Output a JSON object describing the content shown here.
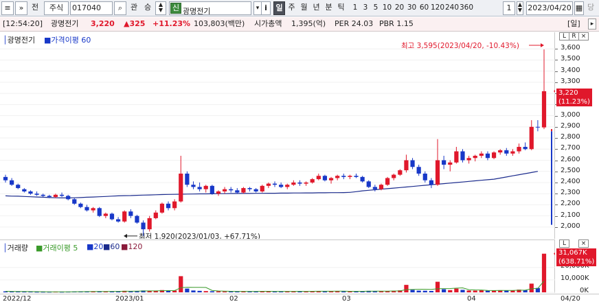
{
  "toolbar": {
    "menu_icon": "hamburger-icon",
    "collapse_icon": "double-chevron-icon",
    "tab_all": "전",
    "market": "주식",
    "code": "017040",
    "search_icon": "magnifier-icon",
    "tab_related": "관",
    "tab_compare": "승",
    "updown_icon": "spin-arrows-icon",
    "stock_tag": "신",
    "stock_name": "광명전기",
    "info_button": "i",
    "periods": [
      "일",
      "주",
      "월",
      "년",
      "분",
      "틱"
    ],
    "selected_period": "일",
    "intervals": [
      "1",
      "3",
      "5",
      "10",
      "20",
      "30",
      "60",
      "120",
      "240",
      "360"
    ],
    "count": "1",
    "date": "2023/04/20",
    "calendar_icon": "calendar-icon",
    "extra": "당"
  },
  "infobar": {
    "time": "[12:54:20]",
    "name": "광명전기",
    "price": "3,220",
    "change": "▲325",
    "pct": "+11.23%",
    "volume": "103,803(백만)",
    "market_cap_label": "시가총액",
    "market_cap": "1,395(억)",
    "per": "PER 24.03",
    "pbr": "PBR 1.15",
    "mode": "[일]",
    "scroll_icon": "scroll-arrow-icon"
  },
  "price_panel": {
    "title": "광명전기",
    "legend": "가격이평 60",
    "max_note": "최고 3,595(2023/04/20, -10.43%)",
    "min_note": "최저 1,920(2023/01/03, +67.71%)",
    "current_label": "3,220",
    "current_pct": "(11.23%)",
    "buttons": [
      "L",
      "R"
    ],
    "colors": {
      "up": "#e0182b",
      "down": "#1838c8",
      "ma": "#1a2a8c"
    }
  },
  "volume_panel": {
    "title": "거래량",
    "legend_ma": "거래이평 5",
    "legend_20": "20",
    "legend_60": "60",
    "legend_120": "120",
    "current_label": "31,067K",
    "current_pct": "(638.71%)",
    "buttons": [
      "L"
    ]
  },
  "x_axis": {
    "labels": [
      "2022/12",
      "2023/01",
      "02",
      "03",
      "04",
      "04/20"
    ]
  },
  "chart_data": [
    {
      "type": "candlestick",
      "title": "광명전기",
      "ylim": [
        1950,
        3700
      ],
      "ticks": [
        2000,
        2100,
        2200,
        2300,
        2400,
        2500,
        2600,
        2700,
        2800,
        2900,
        3000,
        3100,
        3200,
        3300,
        3400,
        3500,
        3600
      ],
      "ma60": [
        2280,
        2278,
        2277,
        2275,
        2272,
        2270,
        2268,
        2265,
        2263,
        2262,
        2262,
        2263,
        2265,
        2268,
        2270,
        2272,
        2275,
        2278,
        2280,
        2282,
        2283,
        2285,
        2287,
        2288,
        2290,
        2292,
        2293,
        2294,
        2295,
        2296,
        2297,
        2298,
        2298,
        2299,
        2300,
        2300,
        2301,
        2301,
        2302,
        2302,
        2303,
        2303,
        2304,
        2304,
        2305,
        2305,
        2306,
        2306,
        2307,
        2307,
        2308,
        2308,
        2309,
        2309,
        2310,
        2312,
        2318,
        2325,
        2330,
        2335,
        2340,
        2345,
        2350,
        2355,
        2360,
        2365,
        2370,
        2375,
        2380,
        2385,
        2390,
        2395,
        2400,
        2405,
        2410,
        2415,
        2420,
        2425,
        2430,
        2440,
        2450,
        2460,
        2470,
        2480,
        2490,
        2500
      ],
      "ohlc": [
        [
          2450,
          2470,
          2400,
          2420
        ],
        [
          2420,
          2440,
          2370,
          2380
        ],
        [
          2380,
          2390,
          2340,
          2350
        ],
        [
          2340,
          2350,
          2310,
          2320
        ],
        [
          2320,
          2330,
          2290,
          2300
        ],
        [
          2300,
          2320,
          2280,
          2290
        ],
        [
          2290,
          2300,
          2270,
          2280
        ],
        [
          2280,
          2290,
          2260,
          2270
        ],
        [
          2270,
          2300,
          2260,
          2290
        ],
        [
          2290,
          2310,
          2270,
          2280
        ],
        [
          2280,
          2290,
          2240,
          2250
        ],
        [
          2250,
          2260,
          2200,
          2210
        ],
        [
          2210,
          2220,
          2170,
          2180
        ],
        [
          2180,
          2200,
          2140,
          2150
        ],
        [
          2150,
          2180,
          2130,
          2170
        ],
        [
          2170,
          2180,
          2090,
          2100
        ],
        [
          2100,
          2130,
          2080,
          2120
        ],
        [
          2120,
          2130,
          2060,
          2070
        ],
        [
          2070,
          2090,
          2040,
          2050
        ],
        [
          2050,
          2150,
          2040,
          2140
        ],
        [
          2140,
          2160,
          2080,
          2100
        ],
        [
          2100,
          2110,
          2030,
          2040
        ],
        [
          2040,
          2060,
          1920,
          1980
        ],
        [
          1980,
          2100,
          1960,
          2080
        ],
        [
          2080,
          2150,
          2070,
          2130
        ],
        [
          2130,
          2220,
          2120,
          2210
        ],
        [
          2210,
          2230,
          2150,
          2170
        ],
        [
          2170,
          2250,
          2150,
          2230
        ],
        [
          2230,
          2640,
          2220,
          2480
        ],
        [
          2480,
          2500,
          2360,
          2380
        ],
        [
          2380,
          2410,
          2340,
          2360
        ],
        [
          2360,
          2400,
          2320,
          2340
        ],
        [
          2340,
          2380,
          2310,
          2370
        ],
        [
          2370,
          2380,
          2290,
          2300
        ],
        [
          2300,
          2330,
          2280,
          2320
        ],
        [
          2320,
          2360,
          2300,
          2340
        ],
        [
          2340,
          2360,
          2310,
          2330
        ],
        [
          2330,
          2350,
          2300,
          2310
        ],
        [
          2310,
          2360,
          2300,
          2350
        ],
        [
          2350,
          2360,
          2320,
          2340
        ],
        [
          2340,
          2350,
          2310,
          2320
        ],
        [
          2320,
          2380,
          2310,
          2370
        ],
        [
          2370,
          2400,
          2350,
          2390
        ],
        [
          2390,
          2410,
          2360,
          2380
        ],
        [
          2380,
          2400,
          2350,
          2360
        ],
        [
          2360,
          2390,
          2340,
          2380
        ],
        [
          2380,
          2420,
          2370,
          2400
        ],
        [
          2400,
          2420,
          2370,
          2390
        ],
        [
          2390,
          2410,
          2370,
          2400
        ],
        [
          2400,
          2440,
          2390,
          2430
        ],
        [
          2430,
          2480,
          2420,
          2460
        ],
        [
          2460,
          2470,
          2410,
          2420
        ],
        [
          2420,
          2450,
          2390,
          2440
        ],
        [
          2440,
          2470,
          2420,
          2460
        ],
        [
          2460,
          2480,
          2430,
          2450
        ],
        [
          2450,
          2470,
          2430,
          2460
        ],
        [
          2460,
          2480,
          2440,
          2450
        ],
        [
          2450,
          2460,
          2400,
          2410
        ],
        [
          2410,
          2420,
          2350,
          2360
        ],
        [
          2360,
          2380,
          2320,
          2340
        ],
        [
          2340,
          2390,
          2330,
          2380
        ],
        [
          2380,
          2450,
          2370,
          2440
        ],
        [
          2440,
          2480,
          2420,
          2470
        ],
        [
          2470,
          2520,
          2460,
          2510
        ],
        [
          2510,
          2650,
          2490,
          2600
        ],
        [
          2600,
          2620,
          2520,
          2540
        ],
        [
          2540,
          2560,
          2460,
          2480
        ],
        [
          2480,
          2500,
          2400,
          2420
        ],
        [
          2420,
          2440,
          2350,
          2380
        ],
        [
          2380,
          2790,
          2370,
          2600
        ],
        [
          2600,
          2640,
          2520,
          2560
        ],
        [
          2560,
          2600,
          2500,
          2580
        ],
        [
          2580,
          2720,
          2570,
          2680
        ],
        [
          2680,
          2700,
          2580,
          2600
        ],
        [
          2600,
          2640,
          2570,
          2620
        ],
        [
          2620,
          2650,
          2590,
          2640
        ],
        [
          2640,
          2680,
          2620,
          2660
        ],
        [
          2660,
          2680,
          2600,
          2620
        ],
        [
          2620,
          2680,
          2610,
          2670
        ],
        [
          2670,
          2700,
          2650,
          2690
        ],
        [
          2690,
          2710,
          2640,
          2660
        ],
        [
          2660,
          2700,
          2640,
          2680
        ],
        [
          2680,
          2750,
          2660,
          2720
        ],
        [
          2720,
          2760,
          2690,
          2700
        ],
        [
          2700,
          2960,
          2690,
          2900
        ],
        [
          2900,
          2960,
          2860,
          2895
        ],
        [
          2895,
          3595,
          2880,
          3220
        ]
      ]
    },
    {
      "type": "bar",
      "title": "거래량",
      "unit": "K",
      "ticks": [
        0,
        10000,
        20000
      ],
      "ylim": [
        0,
        32000
      ],
      "values": [
        800,
        700,
        600,
        500,
        500,
        400,
        400,
        400,
        500,
        400,
        500,
        600,
        700,
        800,
        600,
        900,
        700,
        800,
        900,
        1200,
        900,
        1000,
        1500,
        1100,
        1300,
        1800,
        1200,
        1400,
        13000,
        3000,
        1500,
        1200,
        1000,
        900,
        800,
        700,
        800,
        700,
        900,
        700,
        800,
        900,
        700,
        800,
        700,
        800,
        900,
        800,
        700,
        900,
        1100,
        800,
        900,
        1000,
        800,
        700,
        800,
        900,
        1200,
        1000,
        900,
        1100,
        1300,
        1600,
        6000,
        2000,
        1400,
        1300,
        1100,
        8500,
        2500,
        1800,
        3000,
        2000,
        1500,
        1400,
        1600,
        1300,
        1500,
        1700,
        1500,
        1600,
        2200,
        1800,
        7000,
        3500,
        31067
      ]
    }
  ]
}
